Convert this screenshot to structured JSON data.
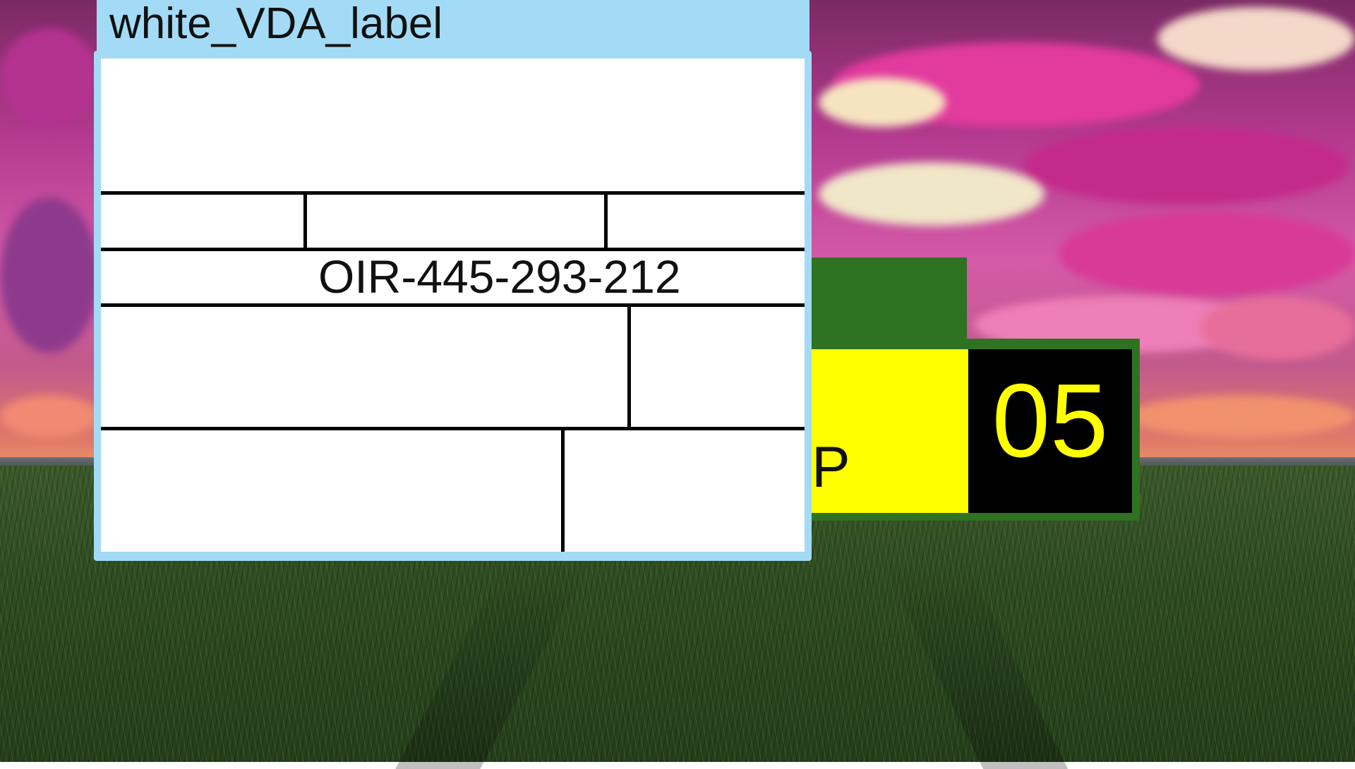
{
  "vda_label_window": {
    "title": "white_VDA_label",
    "part_code": "OIR-445-293-212",
    "titlebar_color": "#a3dbf6",
    "sheet_color": "#ffffff"
  },
  "green_label": {
    "letter": "P",
    "number": "05",
    "colors": {
      "frame": "#2e7222",
      "left_panel": "#ffff00",
      "right_panel": "#000000",
      "number_text": "#ffff00"
    }
  },
  "wallpaper": {
    "icon": "sunset-field-wallpaper"
  }
}
